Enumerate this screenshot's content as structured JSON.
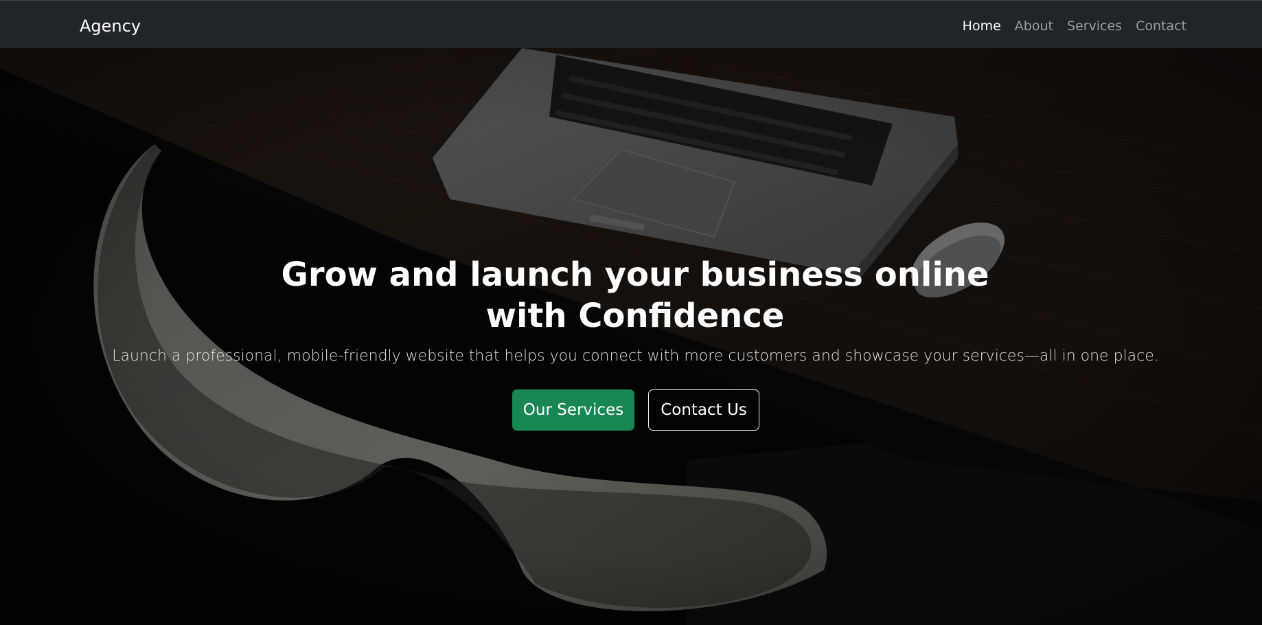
{
  "navbar": {
    "brand": "Agency",
    "links": [
      {
        "label": "Home",
        "active": true
      },
      {
        "label": "About",
        "active": false
      },
      {
        "label": "Services",
        "active": false
      },
      {
        "label": "Contact",
        "active": false
      }
    ]
  },
  "hero": {
    "headline": "Grow and launch your business online with Confidence",
    "subheadline": "Launch a professional, mobile-friendly website that helps you connect with more customers and showcase your services—all in one place.",
    "primary_button": "Our Services",
    "secondary_button": "Contact Us"
  },
  "colors": {
    "navbar_bg": "#212529",
    "primary_button": "#198754",
    "text": "#ffffff"
  }
}
